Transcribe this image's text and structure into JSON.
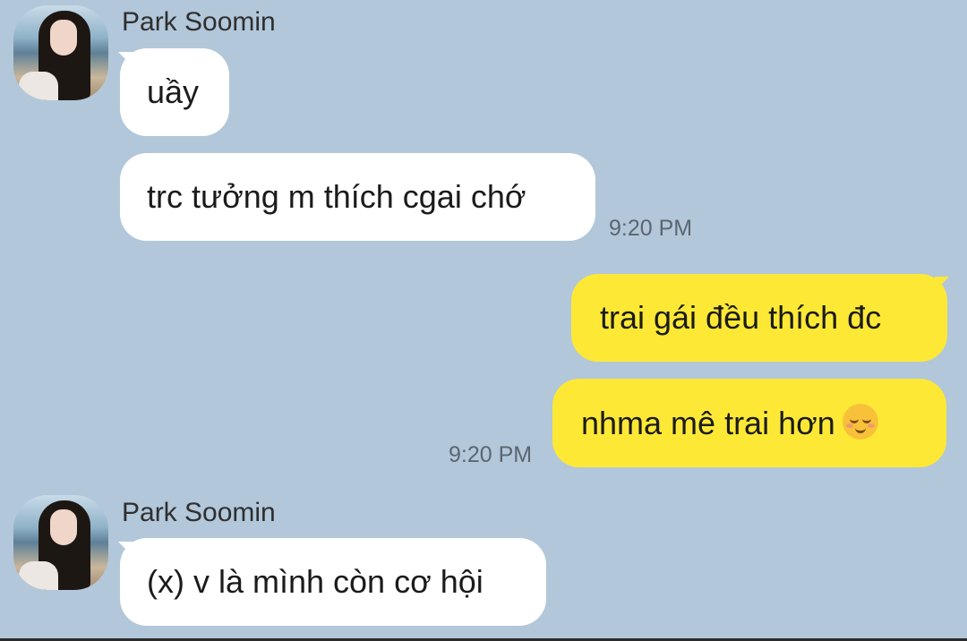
{
  "colors": {
    "background": "#b2c7da",
    "incoming_bubble": "#ffffff",
    "outgoing_bubble": "#fde935",
    "timestamp": "#5c6670"
  },
  "messages": {
    "group1": {
      "sender": "Park Soomin",
      "avatar": "profile-photo",
      "lines": [
        "uầy",
        "trc tưởng m thích cgai chớ"
      ],
      "time": "9:20 PM"
    },
    "group2": {
      "lines": [
        "trai gái đều thích đc",
        "nhma mê trai hơn"
      ],
      "emoji": "smiling-face-with-smiling-eyes",
      "time": "9:20 PM"
    },
    "group3": {
      "sender": "Park Soomin",
      "avatar": "profile-photo",
      "lines": [
        "(x) v là mình còn cơ hội"
      ]
    }
  }
}
